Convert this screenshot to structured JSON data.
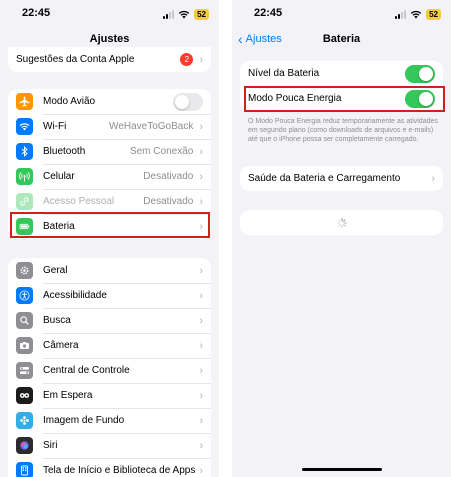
{
  "left": {
    "time": "22:45",
    "battery": "52",
    "title": "Ajustes",
    "account_row": {
      "label": "Sugestões da Conta Apple",
      "badge": "2"
    },
    "connectivity": [
      {
        "label": "Modo Avião",
        "icon": "airplane-icon",
        "color": "#ff9500",
        "toggle": false
      },
      {
        "label": "Wi-Fi",
        "icon": "wifi-icon",
        "color": "#007aff",
        "value": "WeHaveToGoBack"
      },
      {
        "label": "Bluetooth",
        "icon": "bluetooth-icon",
        "color": "#007aff",
        "value": "Sem Conexão"
      },
      {
        "label": "Celular",
        "icon": "antenna-icon",
        "color": "#34c759",
        "value": "Desativado"
      },
      {
        "label": "Acesso Pessoal",
        "icon": "link-icon",
        "color": "#34c759",
        "value": "Desativado",
        "disabled": true
      },
      {
        "label": "Bateria",
        "icon": "battery-icon",
        "color": "#34c759",
        "highlighted": true
      }
    ],
    "general": [
      {
        "label": "Geral",
        "icon": "gear-icon",
        "color": "#8e8e93"
      },
      {
        "label": "Acessibilidade",
        "icon": "accessibility-icon",
        "color": "#007aff"
      },
      {
        "label": "Busca",
        "icon": "search-icon",
        "color": "#8e8e93"
      },
      {
        "label": "Câmera",
        "icon": "camera-icon",
        "color": "#8e8e93"
      },
      {
        "label": "Central de Controle",
        "icon": "control-center-icon",
        "color": "#8e8e93"
      },
      {
        "label": "Em Espera",
        "icon": "standby-icon",
        "color": "#1c1c1e"
      },
      {
        "label": "Imagem de Fundo",
        "icon": "wallpaper-icon",
        "color": "#32ade6"
      },
      {
        "label": "Siri",
        "icon": "siri-icon",
        "color": "#2c2c2e"
      },
      {
        "label": "Tela de Início e Biblioteca de Apps",
        "icon": "home-screen-icon",
        "color": "#007aff"
      }
    ]
  },
  "right": {
    "time": "22:45",
    "battery": "52",
    "back_label": "Ajustes",
    "title": "Bateria",
    "toggles": [
      {
        "label": "Nível da Bateria",
        "toggle": true
      },
      {
        "label": "Modo Pouca Energia",
        "toggle": true,
        "highlighted": true
      }
    ],
    "footer": "O Modo Pouca Energia reduz temporariamente as atividades em segundo plano (como downloads de arquivos e e-mails) até que o iPhone possa ser completamente carregado.",
    "health_row": "Saúde da Bateria e Carregamento"
  },
  "colors": {
    "accent": "#007aff",
    "toggle_on": "#34c759",
    "highlight": "#d0211c",
    "badge": "#ff3b30"
  }
}
